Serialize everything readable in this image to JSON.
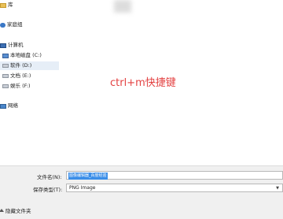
{
  "sidebar": {
    "items": [
      {
        "label": "库",
        "icon": "library-icon"
      },
      {
        "label": "家庭组",
        "icon": "homegroup-icon"
      },
      {
        "label": "计算机",
        "icon": "computer-icon"
      },
      {
        "label": "本地磁盘 (C:)",
        "icon": "drive-icon"
      },
      {
        "label": "软件 (D:)",
        "icon": "drive-icon"
      },
      {
        "label": "文档 (E:)",
        "icon": "drive-icon"
      },
      {
        "label": "娱乐 (F:)",
        "icon": "drive-icon"
      },
      {
        "label": "网络",
        "icon": "network-icon"
      }
    ]
  },
  "overlay_text": "ctrl+m快捷键",
  "form": {
    "filename_label": "文件名(N):",
    "filename_value": "图像编辑器_百度经验",
    "filetype_label": "保存类型(T):",
    "filetype_value": "PNG Image"
  },
  "footer": {
    "hide_folders_label": "隐藏文件夹"
  },
  "colors": {
    "overlay": "#e34141",
    "selection": "#3b8ee8"
  }
}
